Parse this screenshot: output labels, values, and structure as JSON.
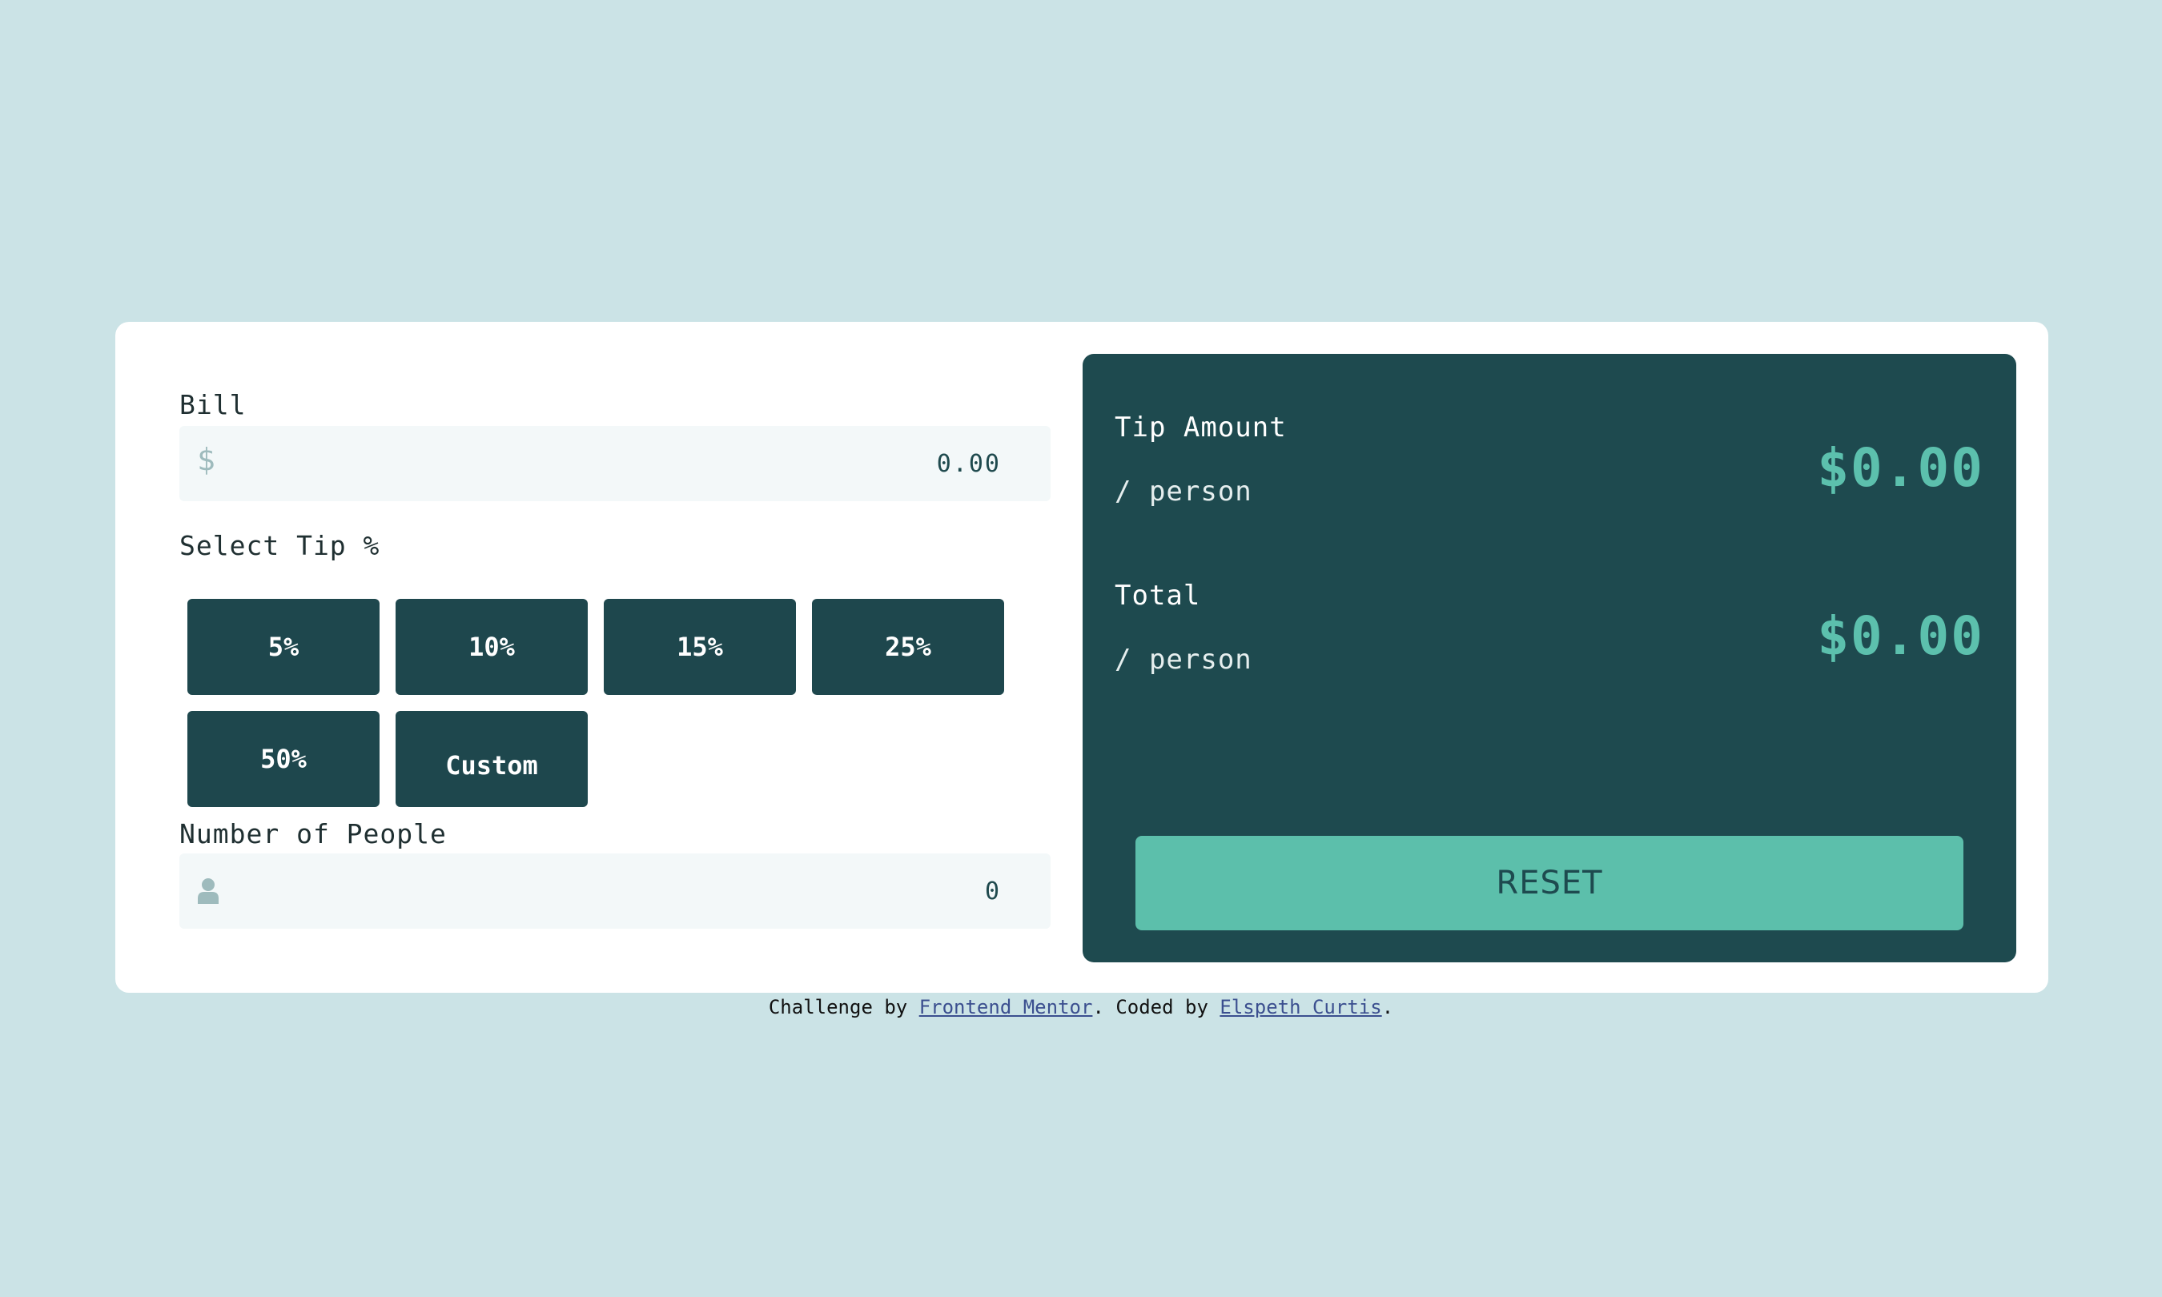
{
  "bill": {
    "label": "Bill",
    "currency_symbol": "$",
    "value": "0.00"
  },
  "tip": {
    "label": "Select Tip %",
    "options": [
      "5%",
      "10%",
      "15%",
      "25%",
      "50%",
      "Custom"
    ]
  },
  "people": {
    "label": "Number of People",
    "value": "0",
    "icon": "person-icon"
  },
  "summary": {
    "tip_label": "Tip Amount",
    "tip_sub": "/ person",
    "tip_value": "$0.00",
    "total_label": "Total",
    "total_sub": "/ person",
    "total_value": "$0.00",
    "reset_label": "RESET"
  },
  "footer": {
    "prefix": "Challenge by ",
    "link1": "Frontend Mentor",
    "middle": ". Coded by ",
    "link2": "Elspeth Curtis",
    "suffix": "."
  },
  "colors": {
    "background": "#cbe3e6",
    "dark_teal": "#1e474d",
    "accent": "#5cbfab",
    "input_bg": "#f3f8f9"
  }
}
